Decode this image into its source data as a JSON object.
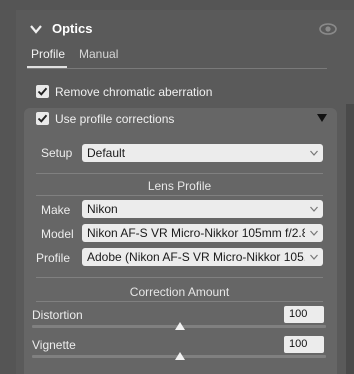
{
  "header": {
    "title": "Optics"
  },
  "tabs": [
    {
      "label": "Profile"
    },
    {
      "label": "Manual"
    }
  ],
  "options": {
    "remove_ca": {
      "label": "Remove chromatic aberration",
      "checked": true
    },
    "use_profile": {
      "label": "Use profile corrections",
      "checked": true
    }
  },
  "setup": {
    "label": "Setup",
    "value": "Default"
  },
  "lens_profile": {
    "title": "Lens Profile",
    "make": {
      "label": "Make",
      "value": "Nikon"
    },
    "model": {
      "label": "Model",
      "value": "Nikon AF-S VR Micro-Nikkor 105mm f/2.8..."
    },
    "profile": {
      "label": "Profile",
      "value": "Adobe (Nikon AF-S VR Micro-Nikkor 105..."
    }
  },
  "correction": {
    "title": "Correction Amount",
    "distortion": {
      "label": "Distortion",
      "value": "100"
    },
    "vignette": {
      "label": "Vignette",
      "value": "100"
    }
  },
  "colors": {
    "panel_bg": "#5a5a5a",
    "subpanel_bg": "#666666",
    "field_bg": "#ececec"
  },
  "icons": {
    "collapse": "chevron-down-icon",
    "visibility": "eye-icon",
    "expand": "triangle-down-icon"
  }
}
